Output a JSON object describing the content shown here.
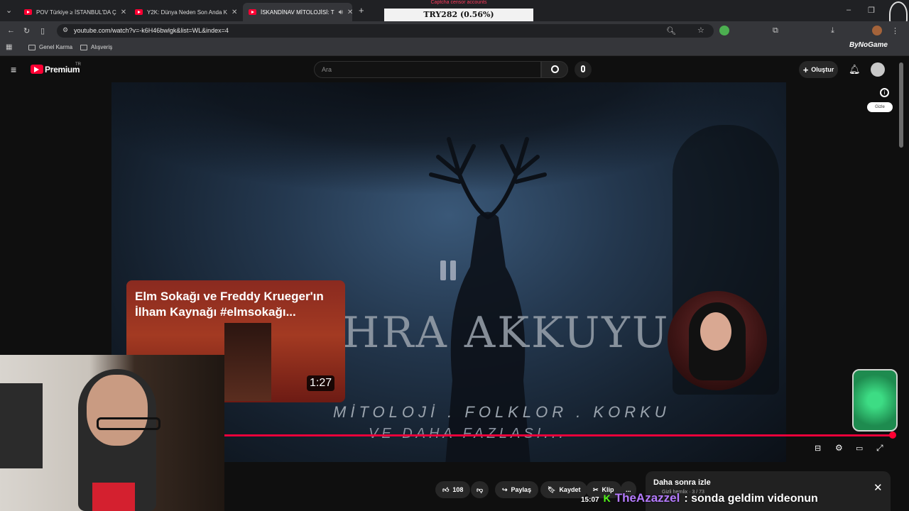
{
  "browser": {
    "tabs": [
      {
        "label": "POV Türkiye ≥ İSTANBUL'DA Ç",
        "active": false
      },
      {
        "label": "Y2K: Dünya Neden Son Anda K",
        "active": false
      },
      {
        "label": "İSKANDİNAV MİTOLOJİSİ: T",
        "active": true
      }
    ],
    "url": "youtube.com/watch?v=-k6H46bwlgk&list=WL&index=4",
    "bookmarks": [
      "Genel Karma",
      "Alışveriş"
    ]
  },
  "overlay": {
    "ticker_header": "Captcha censor accounts",
    "ticker_value": "TRY282 (0.56%)",
    "sponsor": "ByNoGame"
  },
  "youtube": {
    "logo": "Premium",
    "logo_badge": "TR",
    "search_placeholder": "Ara",
    "create_label": "Oluştur",
    "hide_label": "Gizle"
  },
  "video": {
    "title_art": "HRA AKKUYU",
    "subtitle_line1": "MİTOLOJİ . FOLKLOR . KORKU",
    "subtitle_line2": "VE DAHA FAZLASI...",
    "progress_fraction": 0.995
  },
  "card": {
    "title": "Elm Sokağı ve Freddy Krueger'ın İlham Kaynağı #elmsokağı...",
    "duration": "1:27"
  },
  "actions": {
    "like_count": "108",
    "share_label": "Paylaş",
    "save_label": "Kaydet",
    "clip_label": "Klip",
    "more_label": "..."
  },
  "watch_later": {
    "title": "Daha sonra izle",
    "meta": "Gizli  hernlix · 3 / 73"
  },
  "chat": {
    "time": "15:07",
    "user": "TheAzazzel",
    "message": ": sonda geldim videonun"
  },
  "colors": {
    "accent": "#ff0033",
    "progress": "#e9003a",
    "chat_user": "#b57bff"
  }
}
